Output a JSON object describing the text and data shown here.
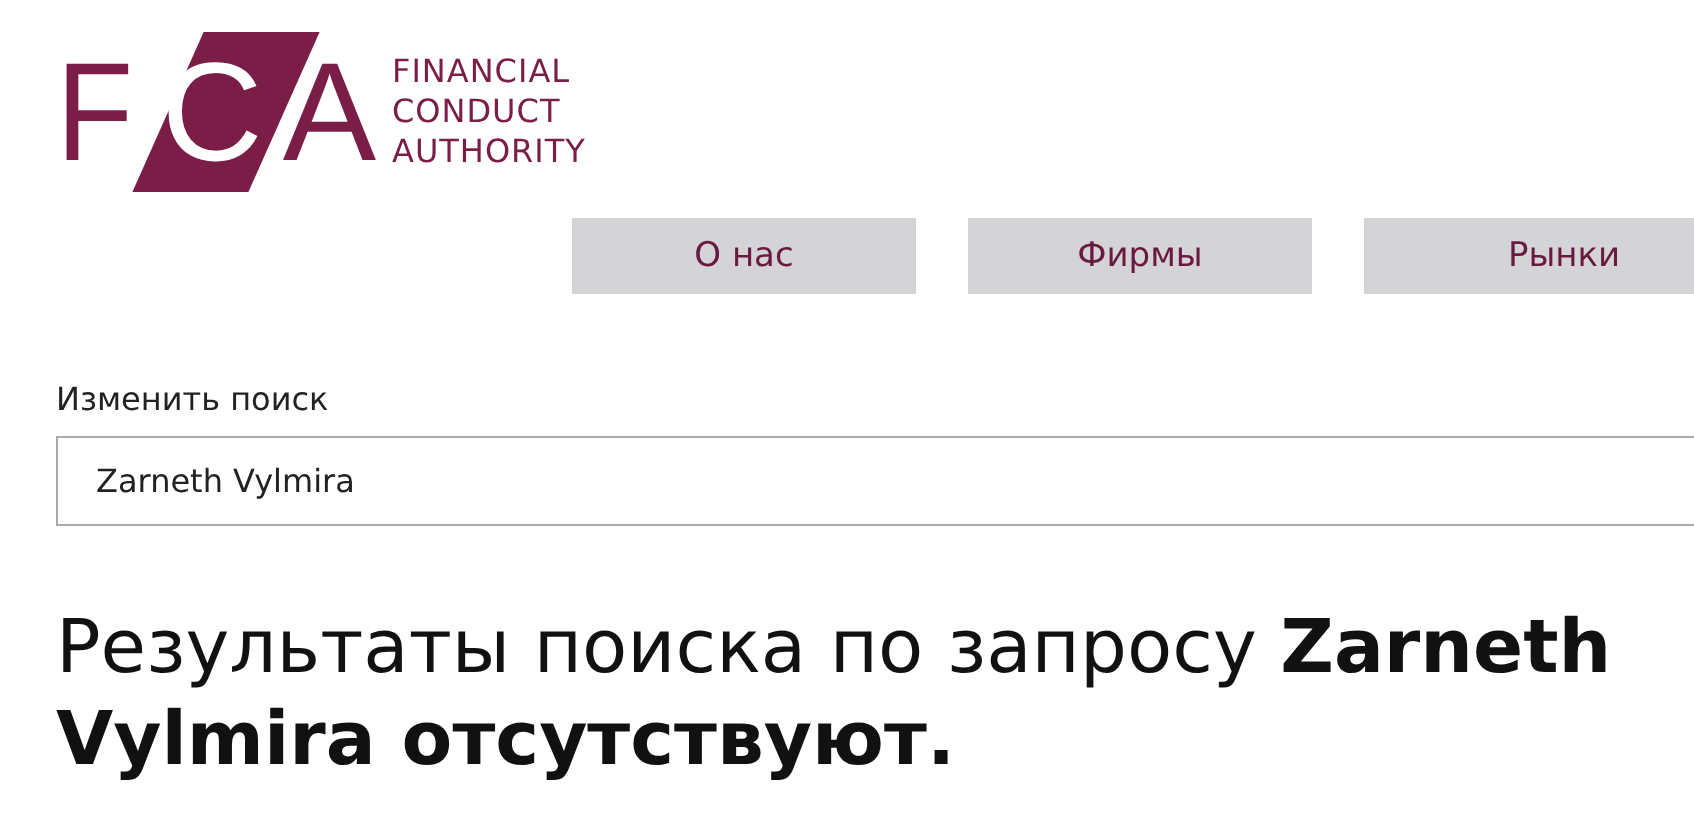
{
  "logo": {
    "letters": [
      "F",
      "C",
      "A"
    ],
    "lines": [
      "FINANCIAL",
      "CONDUCT",
      "AUTHORITY"
    ]
  },
  "nav": [
    {
      "label": "О нас"
    },
    {
      "label": "Фирмы"
    },
    {
      "label": "Рынки"
    }
  ],
  "search": {
    "label": "Изменить поиск",
    "value": "Zarneth Vylmira"
  },
  "result_heading": "Результаты поиска по запросу **Zarneth Vylmira отсутствуют.**"
}
